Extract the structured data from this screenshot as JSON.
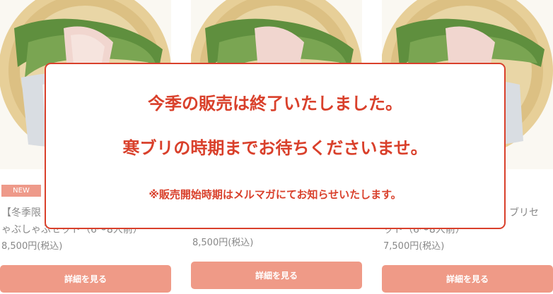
{
  "products": [
    {
      "badge": "NEW",
      "title_line1": "【冬季限",
      "title_line2": "ゃぶしゃぶセット（6～8人前）",
      "price": "8,500円(税込)",
      "button_label": "詳細を見る"
    },
    {
      "badge": "",
      "title_line1": "",
      "title_line2": "",
      "price": "8,500円(税込)",
      "button_label": "詳細を見る"
    },
    {
      "badge": "",
      "title_line1": "ブリセ",
      "title_line2": "ット（6～8人前）",
      "price": "7,500円(税込)",
      "button_label": "詳細を見る"
    }
  ],
  "notice": {
    "line1": "今季の販売は終了いたしました。",
    "line2": "寒ブリの時期までお待ちくださいませ。",
    "line3": "※販売開始時期はメルマガにてお知らせいたします。"
  },
  "colors": {
    "accent": "#d9402b",
    "button": "#ef9a87",
    "badge": "#ee9a8a",
    "text": "#888888"
  },
  "icons": [
    "fish-platter-image"
  ]
}
